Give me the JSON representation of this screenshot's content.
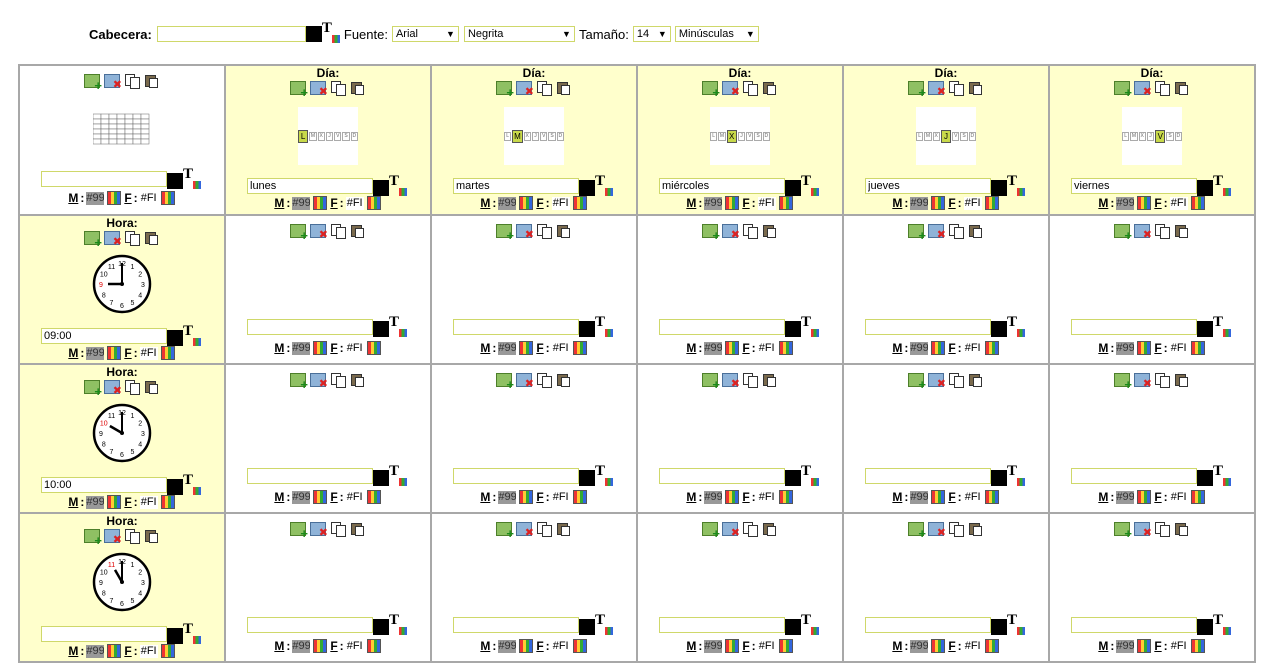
{
  "header": {
    "cabecera_label": "Cabecera:",
    "cabecera_value": "",
    "fuente_label": "Fuente:",
    "fuente_font": "Arial",
    "fuente_style": "Negrita",
    "tamano_label": "Tamaño:",
    "tamano_value": "14",
    "case_value": "Minúsculas"
  },
  "labels": {
    "dia": "Día:",
    "hora": "Hora:",
    "m": "M",
    "f": "F",
    "colon": ":"
  },
  "swatch": {
    "m_value": "#99",
    "f_value": "#FI"
  },
  "days": [
    {
      "letter": "L",
      "name": "lunes"
    },
    {
      "letter": "M",
      "name": "martes"
    },
    {
      "letter": "X",
      "name": "miércoles"
    },
    {
      "letter": "J",
      "name": "jueves"
    },
    {
      "letter": "V",
      "name": "viernes"
    }
  ],
  "day_letters": [
    "L",
    "M",
    "X",
    "J",
    "V",
    "S",
    "D"
  ],
  "hours": [
    "09:00",
    "10:00",
    ""
  ],
  "icons": {
    "add": "add-image-icon",
    "delete": "delete-image-icon",
    "copy": "copy-icon",
    "paste": "paste-icon",
    "text": "text-color-icon"
  },
  "colors": {
    "header_cell": "#ffffcc",
    "border": "#a8a8a8",
    "input_border": "#cfd86a",
    "highlight_day": "#c8d94a"
  }
}
